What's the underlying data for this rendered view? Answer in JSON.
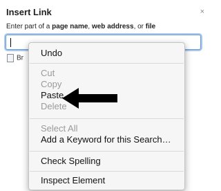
{
  "dialog": {
    "title": "Insert Link",
    "close_glyph": "×",
    "hint": {
      "prefix": "Enter part of a ",
      "term1": "page name",
      "sep1": ", ",
      "term2": "web address",
      "sep2": ", or ",
      "term3": "file"
    },
    "input_value": "",
    "result_label": "Br"
  },
  "context_menu": {
    "undo": "Undo",
    "cut": "Cut",
    "copy": "Copy",
    "paste": "Paste",
    "delete": "Delete",
    "select_all": "Select All",
    "add_keyword": "Add a Keyword for this Search…",
    "check_spelling": "Check Spelling",
    "inspect_element": "Inspect Element"
  },
  "colors": {
    "input_focus": "#6d9ad2",
    "menu_bg": "#f6f6f6",
    "disabled_text": "#9a9a9a"
  }
}
